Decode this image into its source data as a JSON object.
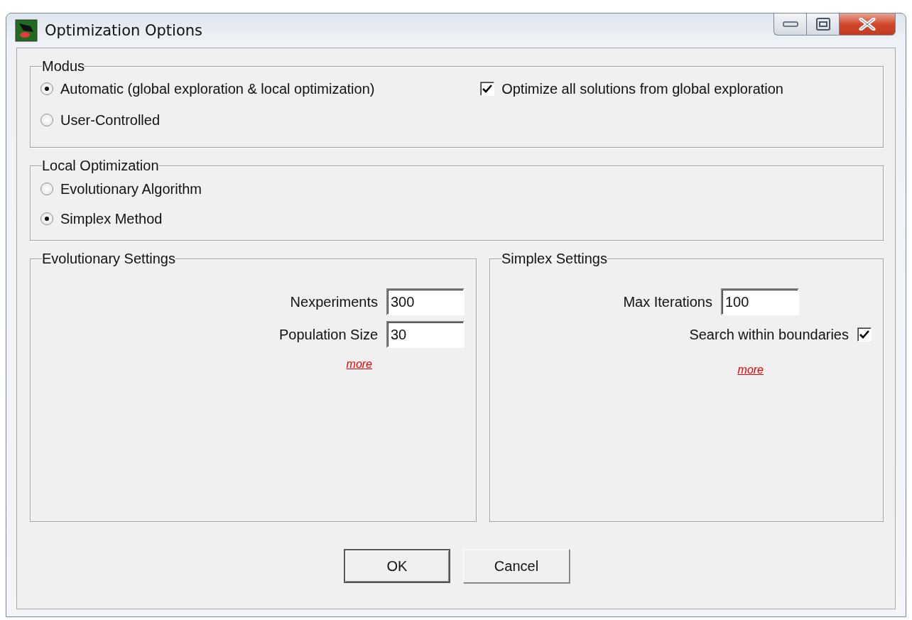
{
  "window": {
    "title": "Optimization Options"
  },
  "modus": {
    "label": "Modus",
    "options": [
      {
        "label": "Automatic (global exploration & local optimization)",
        "selected": true
      },
      {
        "label": "User-Controlled",
        "selected": false
      }
    ],
    "optimize_all": {
      "label": "Optimize all solutions from global exploration",
      "checked": true
    }
  },
  "local_optimization": {
    "label": "Local Optimization",
    "options": [
      {
        "label": "Evolutionary Algorithm",
        "selected": false
      },
      {
        "label": "Simplex Method",
        "selected": true
      }
    ]
  },
  "evolutionary_settings": {
    "label": "Evolutionary Settings",
    "fields": [
      {
        "label": "Nexperiments",
        "value": "300"
      },
      {
        "label": "Population Size",
        "value": "30"
      }
    ],
    "more_link": "more"
  },
  "simplex_settings": {
    "label": "Simplex Settings",
    "fields": [
      {
        "label": "Max Iterations",
        "value": "100"
      }
    ],
    "search_within_boundaries": {
      "label": "Search within boundaries",
      "checked": true
    },
    "more_link": "more"
  },
  "buttons": [
    {
      "label": "OK",
      "default": true
    },
    {
      "label": "Cancel",
      "default": false
    }
  ]
}
